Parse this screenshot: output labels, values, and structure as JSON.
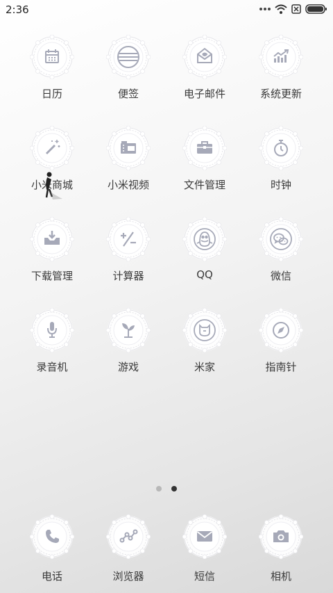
{
  "status_bar": {
    "time": "2:36"
  },
  "apps": [
    {
      "label": "日历",
      "icon": "calendar-icon"
    },
    {
      "label": "便签",
      "icon": "notes-icon"
    },
    {
      "label": "电子邮件",
      "icon": "email-icon"
    },
    {
      "label": "系统更新",
      "icon": "update-icon"
    },
    {
      "label": "小米商城",
      "icon": "magic-wand-icon"
    },
    {
      "label": "小米视频",
      "icon": "video-icon"
    },
    {
      "label": "文件管理",
      "icon": "briefcase-icon"
    },
    {
      "label": "时钟",
      "icon": "stopwatch-icon"
    },
    {
      "label": "下载管理",
      "icon": "download-icon"
    },
    {
      "label": "计算器",
      "icon": "calculator-icon"
    },
    {
      "label": "QQ",
      "icon": "qq-penguin-icon"
    },
    {
      "label": "微信",
      "icon": "wechat-icon"
    },
    {
      "label": "录音机",
      "icon": "microphone-icon"
    },
    {
      "label": "游戏",
      "icon": "sprout-icon"
    },
    {
      "label": "米家",
      "icon": "mijia-icon"
    },
    {
      "label": "指南针",
      "icon": "compass-icon"
    }
  ],
  "page_indicator": {
    "total": 2,
    "active": 2
  },
  "dock": [
    {
      "label": "电话",
      "icon": "phone-icon"
    },
    {
      "label": "浏览器",
      "icon": "browser-icon"
    },
    {
      "label": "短信",
      "icon": "message-icon"
    },
    {
      "label": "相机",
      "icon": "camera-icon"
    }
  ],
  "colors": {
    "icon_stroke": "#a6a9b8",
    "icon_fill": "#ffffff"
  }
}
